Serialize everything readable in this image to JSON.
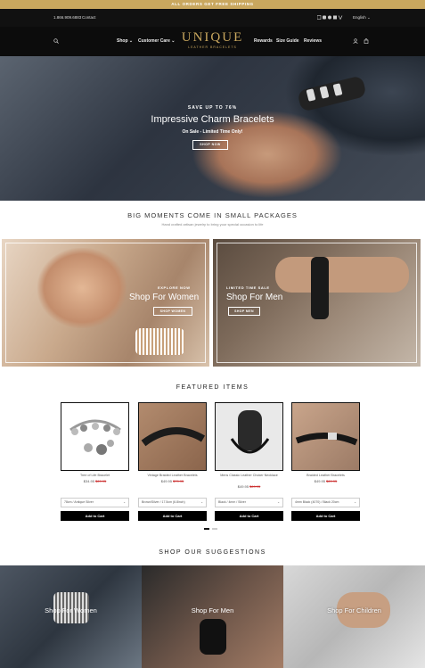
{
  "promo": {
    "text": "ALL ORDERS GET FREE SHIPPING"
  },
  "topbar": {
    "phone": "1.866.909.6883",
    "contact": "Contact",
    "language": "English"
  },
  "nav": {
    "logo": "UNIQUE",
    "logo_sub": "LEATHER BRACELETS",
    "left_links": [
      "Shop",
      "Customer Care"
    ],
    "right_links": [
      "Rewards",
      "Size Guide",
      "Reviews"
    ]
  },
  "hero": {
    "eyebrow": "SAVE UP TO 76%",
    "title": "Impressive Charm Bracelets",
    "subtitle": "On Sale - Limited Time Only!",
    "button": "SHOP NOW"
  },
  "moments": {
    "title": "BIG MOMENTS COME IN SMALL PACKAGES",
    "subtitle": "Hand crafted artisan jewelry to bring your special occasion to life"
  },
  "banners": [
    {
      "eyebrow": "EXPLORE NOW",
      "title": "Shop For Women",
      "button": "SHOP WOMEN"
    },
    {
      "eyebrow": "LIMITED TIME SALE",
      "title": "Shop For Men",
      "button": "SHOP MEN"
    }
  ],
  "featured": {
    "title": "FEATURED ITEMS",
    "products": [
      {
        "name": "Tree of Life Bracelet",
        "sale": "$34.95",
        "orig": "$69.95",
        "option": "78cm / Antique Silver",
        "cart": "Add to Cart"
      },
      {
        "name": "Vintage Braided Leather Bracelets",
        "sale": "$49.95",
        "orig": "$79.95",
        "option": "Brown/Silver / 17.5cm (6.8inch)",
        "cart": "Add to Cart"
      },
      {
        "name": "Mens Classic Leather Choker Necklace",
        "sale": "$49.95",
        "orig": "$69.95",
        "option": "Black / 4mm / Silver",
        "cart": "Add to Cart"
      },
      {
        "name": "Braided Leather Bracelets",
        "sale": "$49.95",
        "orig": "$69.95",
        "option": "4mm Black (4070) / Black 20cm",
        "cart": "Add to Cart"
      }
    ]
  },
  "suggestions": {
    "title": "SHOP OUR SUGGESTIONS",
    "items": [
      "Shop For Women",
      "Shop For Men",
      "Shop For Children"
    ]
  }
}
